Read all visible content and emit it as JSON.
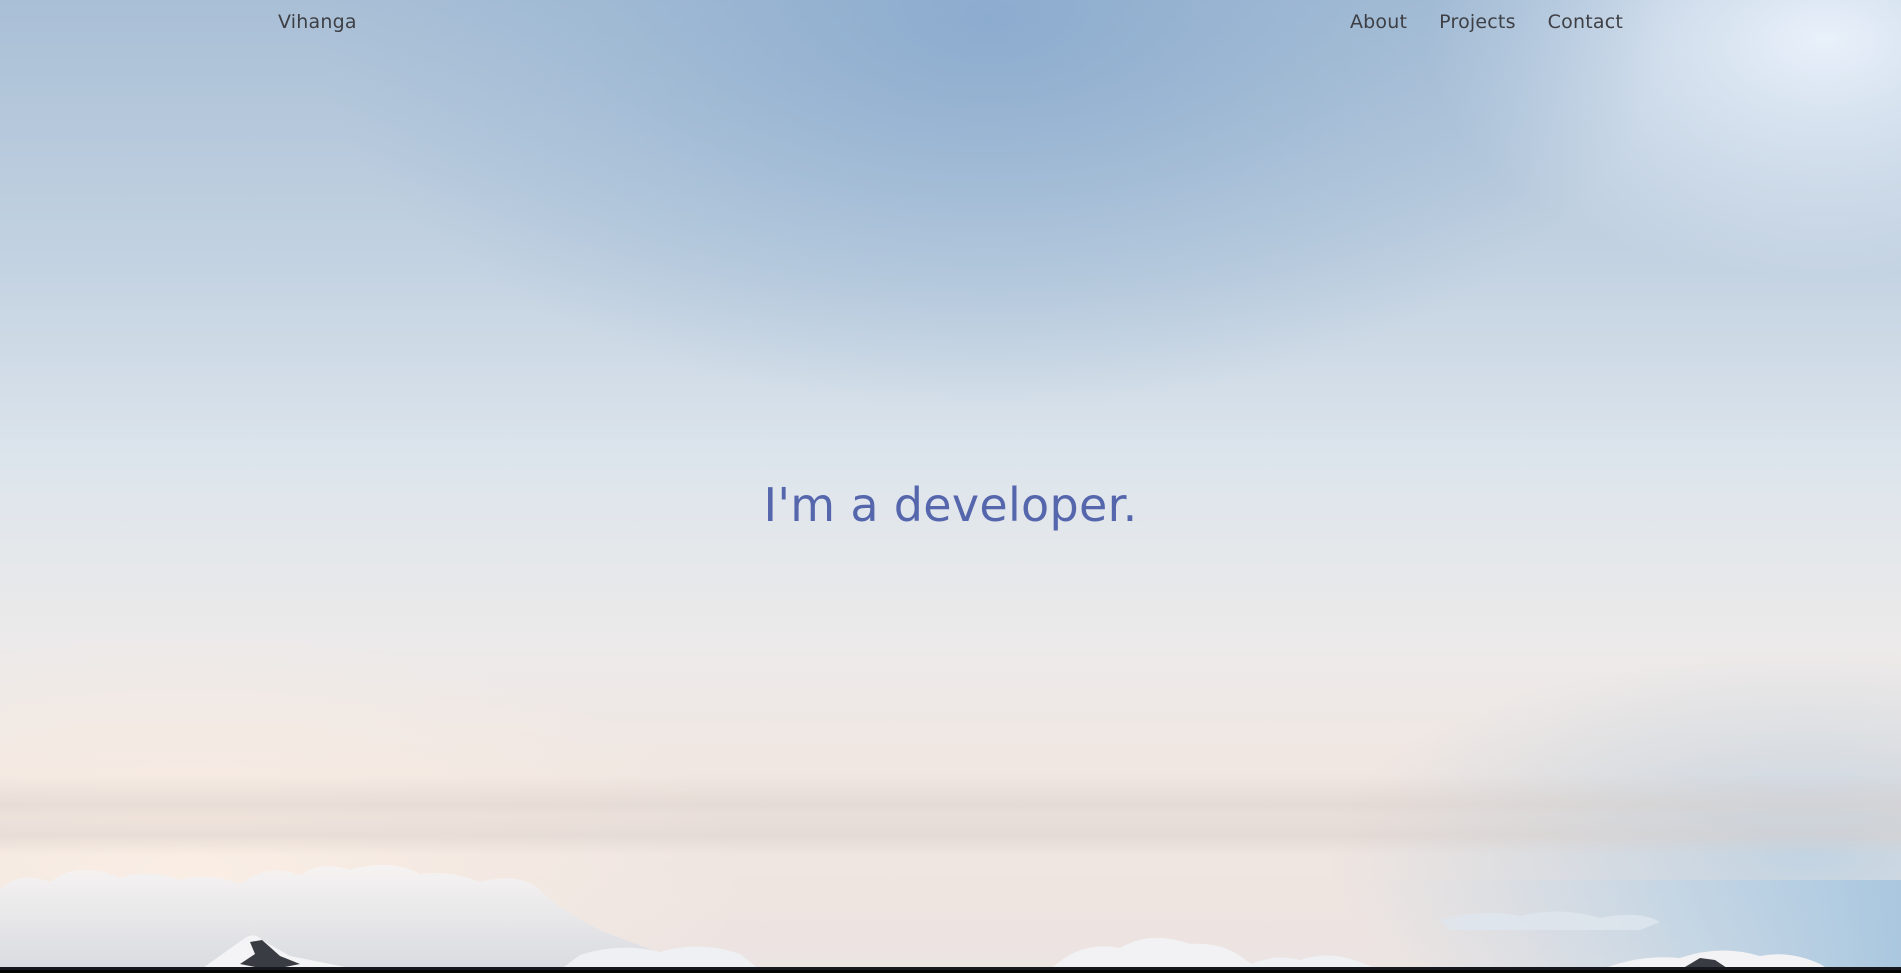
{
  "nav": {
    "brand": "Vihanga",
    "links": [
      {
        "label": "About"
      },
      {
        "label": "Projects"
      },
      {
        "label": "Contact"
      }
    ]
  },
  "hero": {
    "headline": "I'm a developer.",
    "background_image": "sky-with-clouds-and-snowy-mountains",
    "headline_color": "#5566ad",
    "nav_text_color": "#3d3f44"
  }
}
